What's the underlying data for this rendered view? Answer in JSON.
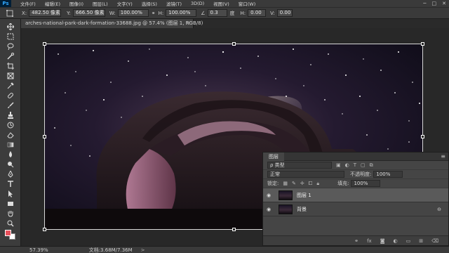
{
  "menubar": {
    "logo": "Ps",
    "items": [
      "文件(F)",
      "编辑(E)",
      "图像(I)",
      "图层(L)",
      "文字(Y)",
      "选择(S)",
      "滤镜(T)",
      "3D(D)",
      "视图(V)",
      "窗口(W)"
    ],
    "window_buttons": [
      "─",
      "□",
      "✕"
    ]
  },
  "options": {
    "x_label": "X:",
    "x_value": "482.50 像素",
    "y_label": "Y:",
    "y_value": "666.50 像素",
    "w_label": "W:",
    "w_value": "100.00%",
    "h_label": "H:",
    "h_value": "100.00%",
    "angle_value": "0.3",
    "angle_unit": "度",
    "hskew_label": "H:",
    "hskew_value": "0.00",
    "vskew_label": "V:",
    "vskew_value": "0.00"
  },
  "document": {
    "tab_title": "arches-national-park-dark-formation-33688.jpg @ 57.4% (图层 1, RGB/8)",
    "close": "×"
  },
  "layers_panel": {
    "tab_label": "图层",
    "kind_label": "ρ 类型",
    "blend_mode": "正常",
    "opacity_label": "不透明度:",
    "opacity_value": "100%",
    "lock_label": "锁定:",
    "fill_label": "填充:",
    "fill_value": "100%",
    "layers": [
      {
        "name": "图层 1",
        "selected": true,
        "locked": false
      },
      {
        "name": "背景",
        "selected": false,
        "locked": true
      }
    ],
    "bottom_icons": [
      "link-icon",
      "fx-icon",
      "mask-icon",
      "adjustment-icon",
      "folder-icon",
      "new-layer-icon",
      "trash-icon"
    ]
  },
  "status": {
    "zoom": "57.39%",
    "doc_size": "文档:3.68M/7.36M",
    "arrow": ">"
  },
  "colors": {
    "foreground": "#e8505b",
    "background": "#ffffff",
    "accent": "#31a8ff"
  }
}
